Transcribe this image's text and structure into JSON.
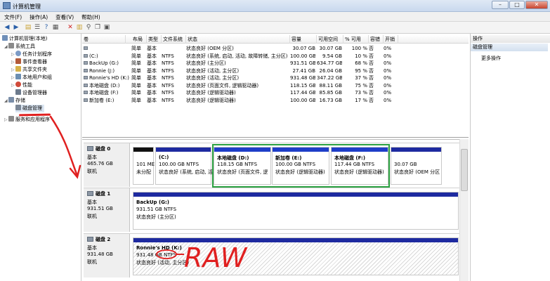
{
  "window": {
    "title": "计算机管理"
  },
  "menu": [
    "文件(F)",
    "操作(A)",
    "查看(V)",
    "帮助(H)"
  ],
  "toolbar_icons": [
    "back-arrow-icon",
    "forward-arrow-icon",
    "folder-icon",
    "list-icon",
    "help-icon",
    "details-icon",
    "delete-icon",
    "folder-open-icon",
    "search-icon",
    "copy-icon",
    "properties-icon"
  ],
  "tree": {
    "root": "计算机管理(本地)",
    "system_tools": "系统工具",
    "task_scheduler": "任务计划程序",
    "event_viewer": "事件查看器",
    "shared_folders": "共享文件夹",
    "local_users": "本地用户和组",
    "performance": "性能",
    "device_manager": "设备管理器",
    "storage": "存储",
    "disk_management": "磁盘管理",
    "services": "服务和应用程序"
  },
  "volumes": {
    "columns": [
      "卷",
      "布局",
      "类型",
      "文件系统",
      "状态",
      "容量",
      "可用空间",
      "% 可用",
      "容错",
      "开销"
    ],
    "rows": [
      [
        "",
        "简单",
        "基本",
        "",
        "状态良好 (OEM 分区)",
        "30.07 GB",
        "30.07 GB",
        "100 %",
        "否",
        "0%"
      ],
      [
        "(C:)",
        "简单",
        "基本",
        "NTFS",
        "状态良好 (系统, 启动, 活动, 故障转储, 主分区)",
        "100.00 GB",
        "9.54 GB",
        "10 %",
        "否",
        "0%"
      ],
      [
        "BackUp (G:)",
        "简单",
        "基本",
        "NTFS",
        "状态良好 (主分区)",
        "931.51 GB",
        "634.77 GB",
        "68 %",
        "否",
        "0%"
      ],
      [
        "Ronnie (J:)",
        "简单",
        "基本",
        "NTFS",
        "状态良好 (活动, 主分区)",
        "27.41 GB",
        "26.04 GB",
        "95 %",
        "否",
        "0%"
      ],
      [
        "Ronnie's HD (K:)",
        "简单",
        "基本",
        "NTFS",
        "状态良好 (活动, 主分区)",
        "931.48 GB",
        "347.22 GB",
        "37 %",
        "否",
        "0%"
      ],
      [
        "本地磁盘 (D:)",
        "简单",
        "基本",
        "NTFS",
        "状态良好 (页面文件, 逻辑驱动器)",
        "118.15 GB",
        "88.11 GB",
        "75 %",
        "否",
        "0%"
      ],
      [
        "本地磁盘 (F:)",
        "简单",
        "基本",
        "NTFS",
        "状态良好 (逻辑驱动器)",
        "117.44 GB",
        "85.85 GB",
        "73 %",
        "否",
        "0%"
      ],
      [
        "新加卷 (E:)",
        "简单",
        "基本",
        "NTFS",
        "状态良好 (逻辑驱动器)",
        "100.00 GB",
        "16.73 GB",
        "17 %",
        "否",
        "0%"
      ]
    ]
  },
  "disks": [
    {
      "name": "磁盘 0",
      "type": "基本",
      "size": "465.76 GB",
      "status": "联机",
      "partitions": [
        {
          "title": "",
          "size": "101 ME",
          "desc": "未分配",
          "color": "#111111"
        },
        {
          "title": "(C:)",
          "size": "100.00 GB NTFS",
          "desc": "状态良好 (系统, 启动, 活动, 故障",
          "color": "#1e2aa0"
        },
        {
          "title": "本地磁盘 (D:)",
          "size": "118.15 GB NTFS",
          "desc": "状态良好 (页面文件, 逻",
          "color": "#1e3ec8"
        },
        {
          "title": "新加卷 (E:)",
          "size": "100.00 GB NTFS",
          "desc": "状态良好 (逻辑驱动器)",
          "color": "#1e3ec8"
        },
        {
          "title": "本地磁盘 (F:)",
          "size": "117.44 GB NTFS",
          "desc": "状态良好 (逻辑驱动器)",
          "color": "#1e3ec8"
        },
        {
          "title": "",
          "size": "30.07 GB",
          "desc": "状态良好 (OEM 分区",
          "color": "#1e2aa0"
        }
      ]
    },
    {
      "name": "磁盘 1",
      "type": "基本",
      "size": "931.51 GB",
      "status": "联机",
      "partitions": [
        {
          "title": "BackUp (G:)",
          "size": "931.51 GB NTFS",
          "desc": "状态良好 (主分区)",
          "color": "#1e2aa0"
        }
      ]
    },
    {
      "name": "磁盘 2",
      "type": "基本",
      "size": "931.48 GB",
      "status": "联机",
      "partitions": [
        {
          "title": "Ronnie's HD (K:)",
          "size": "931.48 GB NTFS",
          "desc": "状态良好 (活动, 主分区)",
          "color": "#1e2aa0"
        }
      ]
    }
  ],
  "actions": {
    "header": "操作",
    "section": "磁盘管理",
    "more": "更多操作"
  },
  "annotation": {
    "text": "RAW",
    "color": "#e02020"
  }
}
